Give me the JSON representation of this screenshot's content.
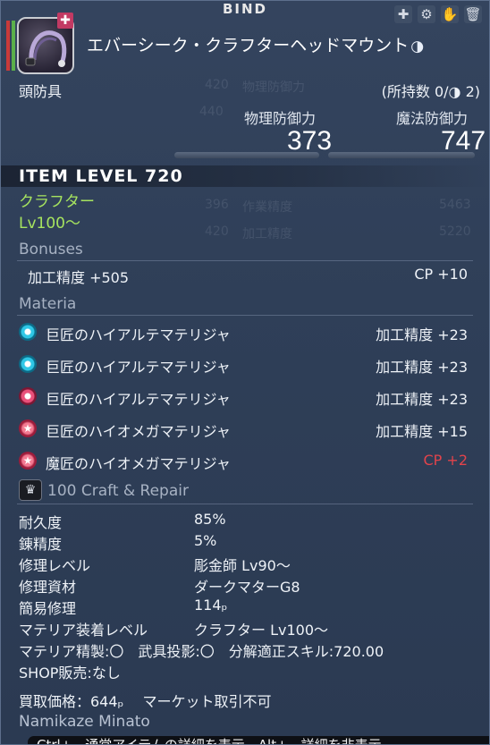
{
  "header": {
    "bind_label": "BIND",
    "top_icons": [
      "plus-icon",
      "gear-icon",
      "hand-icon",
      "trash-icon"
    ]
  },
  "item": {
    "name": "エバーシーク・クラフターヘッドマウント",
    "hq_symbol": "◑",
    "craft_mark": "✚",
    "category": "頭防具",
    "owned": "(所持数 0/",
    "owned_hq": "◑",
    "owned_end": " 2)"
  },
  "defense": {
    "physical_label": "物理防御力",
    "physical_value": "373",
    "magical_label": "魔法防御力",
    "magical_value": "747"
  },
  "item_level": "ITEM LEVEL 720",
  "requirements": {
    "class": "クラフター",
    "level": "Lv100～"
  },
  "bonuses": {
    "title": "Bonuses",
    "left": "加工精度 +505",
    "right": "CP +10"
  },
  "materia": {
    "title": "Materia",
    "slots": [
      {
        "name": "巨匠のハイアルテマテリジャ",
        "value": "加工精度 +23",
        "icon": "blue-materia-icon",
        "value_color": "#eef2f7"
      },
      {
        "name": "巨匠のハイアルテマテリジャ",
        "value": "加工精度 +23",
        "icon": "blue-materia-icon",
        "value_color": "#eef2f7"
      },
      {
        "name": "巨匠のハイアルテマテリジャ",
        "value": "加工精度 +23",
        "icon": "red-materia-icon",
        "value_color": "#eef2f7"
      },
      {
        "name": "巨匠のハイオメガマテリジャ",
        "value": "加工精度 +15",
        "icon": "star-materia-icon",
        "value_color": "#eef2f7"
      },
      {
        "name": "魔匠のハイオメガマテリジャ",
        "value": "CP +2",
        "icon": "star-materia-icon",
        "value_color": "#e2434b"
      }
    ]
  },
  "craft_repair": {
    "title": "100 Craft & Repair",
    "rows": [
      {
        "label": "耐久度",
        "value": "85%"
      },
      {
        "label": "錬精度",
        "value": "5%"
      },
      {
        "label": "修理レベル",
        "value": "彫金師 Lv90～"
      },
      {
        "label": "修理資材",
        "value": "ダークマターG8"
      },
      {
        "label": "簡易修理",
        "value": "114ₚ"
      },
      {
        "label": "マテリア装着レベル",
        "value": "クラフター Lv100～"
      }
    ],
    "line1": "マテリア精製:〇　武具投影:〇　分解適正スキル:720.00",
    "line2": "SHOP販売:なし",
    "line3": "買取価格：644ₚ　 マーケット取引不可"
  },
  "signature": "Namikaze Minato",
  "footer_hint": "Ctrl+　通常アイテムの詳細を表示　Alt+　詳細を非表示",
  "ghost_text": [
    "420",
    "物理防御力",
    "440",
    "魔法防御力",
    "420",
    "396",
    "作業精度",
    "5463",
    "420",
    "加工精度",
    "5220"
  ]
}
